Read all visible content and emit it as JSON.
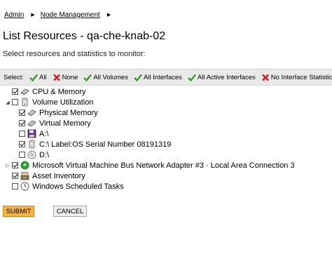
{
  "breadcrumb": {
    "items": [
      "Admin",
      "Node Management"
    ]
  },
  "page": {
    "title": "List Resources - qa-che-knab-02",
    "subtitle": "Select resources and statistics to monitor:"
  },
  "select_bar": {
    "label": "Select:",
    "all": "All",
    "none": "None",
    "all_volumes": "All Volumes",
    "all_interfaces": "All Interfaces",
    "all_active_interfaces": "All Active Interfaces",
    "no_interface_statistics": "No Interface Statistics"
  },
  "tree": {
    "cpu": "CPU & Memory",
    "volume_utilization": "Volume Utilization",
    "physical_memory": "Physical Memory",
    "virtual_memory": "Virtual Memory",
    "drive_a": "A:\\",
    "drive_c": "C:\\ Label:OS Serial Number 08191319",
    "drive_d": "D:\\",
    "network_adapter": "Microsoft Virtual Machine Bus Network Adapter #3 · Local Area Connection 3",
    "asset_inventory": "Asset Inventory",
    "scheduled_tasks": "Windows Scheduled Tasks"
  },
  "buttons": {
    "submit": "SUBMIT",
    "cancel": "CANCEL"
  },
  "colors": {
    "check_green": "#3a9a2a",
    "cross_red": "#d42020",
    "submit_bg": "#f2b64b"
  }
}
